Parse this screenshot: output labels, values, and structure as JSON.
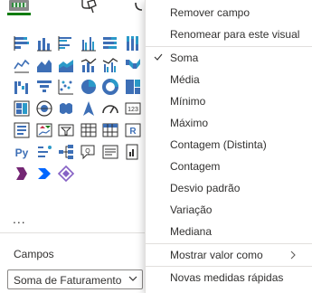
{
  "pane": {
    "campos_label": "Campos",
    "field_well_value": "Soma de Faturamento",
    "more_visuals": "..."
  },
  "tabs": [
    {
      "name": "build-visual-tab",
      "icon": "build-visual-icon",
      "active": true
    },
    {
      "name": "format-visual-tab",
      "icon": "paint-roller-icon",
      "active": false
    },
    {
      "name": "analytics-tab",
      "icon": "magnifier-icon",
      "active": false
    }
  ],
  "visual_icons": [
    "stacked-bar-chart-icon",
    "stacked-column-chart-icon",
    "clustered-bar-chart-icon",
    "clustered-column-chart-icon",
    "100-stacked-bar-chart-icon",
    "100-stacked-column-chart-icon",
    "line-chart-icon",
    "area-chart-icon",
    "stacked-area-chart-icon",
    "line-and-stacked-column-icon",
    "line-and-clustered-column-icon",
    "ribbon-chart-icon",
    "waterfall-chart-icon",
    "funnel-chart-icon",
    "scatter-chart-icon",
    "pie-chart-icon",
    "donut-chart-icon",
    "treemap-icon",
    "map-icon",
    "filled-map-icon",
    "shape-map-icon",
    "azure-map-icon",
    "gauge-icon",
    "card-icon",
    "multi-row-card-icon",
    "kpi-icon",
    "slicer-icon",
    "table-icon",
    "matrix-icon",
    "r-visual-icon",
    "python-visual-icon",
    "key-influencers-icon",
    "decomposition-tree-icon",
    "qa-icon",
    "smart-narrative-icon",
    "paginated-report-icon",
    "power-apps-icon",
    "power-automate-icon",
    "diamond-visual-icon"
  ],
  "context_menu": {
    "items": [
      {
        "label": "Remover campo",
        "checked": false,
        "submenu": false
      },
      {
        "label": "Renomear para este visual",
        "checked": false,
        "submenu": false
      },
      {
        "label": "Soma",
        "checked": true,
        "submenu": false
      },
      {
        "label": "Média",
        "checked": false,
        "submenu": false
      },
      {
        "label": "Mínimo",
        "checked": false,
        "submenu": false
      },
      {
        "label": "Máximo",
        "checked": false,
        "submenu": false
      },
      {
        "label": "Contagem (Distinta)",
        "checked": false,
        "submenu": false
      },
      {
        "label": "Contagem",
        "checked": false,
        "submenu": false
      },
      {
        "label": "Desvio padrão",
        "checked": false,
        "submenu": false
      },
      {
        "label": "Variação",
        "checked": false,
        "submenu": false
      },
      {
        "label": "Mediana",
        "checked": false,
        "submenu": false
      },
      {
        "label": "Mostrar valor como",
        "checked": false,
        "submenu": true
      },
      {
        "label": "Novas medidas rápidas",
        "checked": false,
        "submenu": false
      }
    ]
  },
  "colors": {
    "accent_green": "#107c10",
    "chart_blue": "#3d6fb6",
    "chart_teal": "#2b9ac9",
    "menu_text": "#323130",
    "divider": "#e1dfdd"
  }
}
